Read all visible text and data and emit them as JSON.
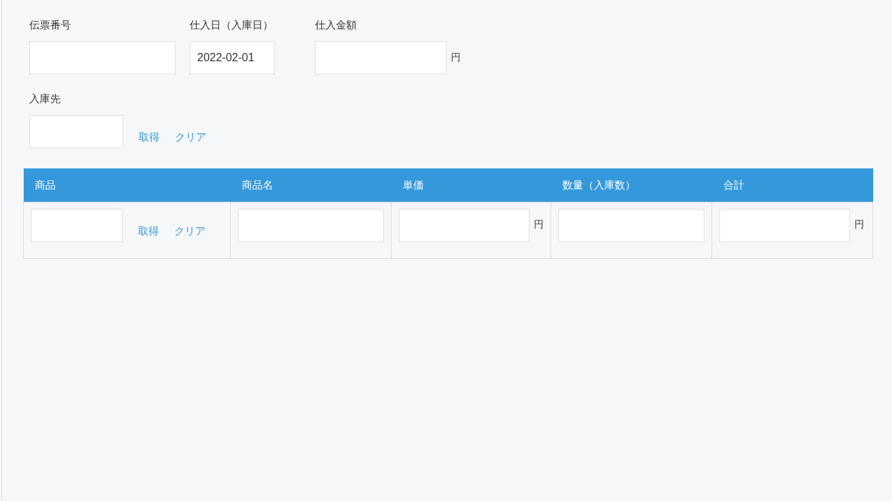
{
  "header_fields": [
    {
      "label": "伝票番号"
    },
    {
      "label": "仕入日（入庫日）",
      "value": "2022-02-01"
    },
    {
      "label": "仕入金額",
      "unit": "円"
    }
  ],
  "destination": {
    "label": "入庫先",
    "links": [
      "取得",
      "クリア"
    ]
  },
  "table": {
    "columns": [
      "商品",
      "商品名",
      "単価",
      "数量（入庫数）",
      "合計"
    ],
    "rows": [
      {
        "cells": [
          {
            "kind": "lookup",
            "links": [
              "取得",
              "クリア"
            ]
          },
          {
            "kind": "input"
          },
          {
            "kind": "input",
            "unit": "円"
          },
          {
            "kind": "input"
          },
          {
            "kind": "input",
            "unit": "円"
          }
        ]
      }
    ]
  }
}
